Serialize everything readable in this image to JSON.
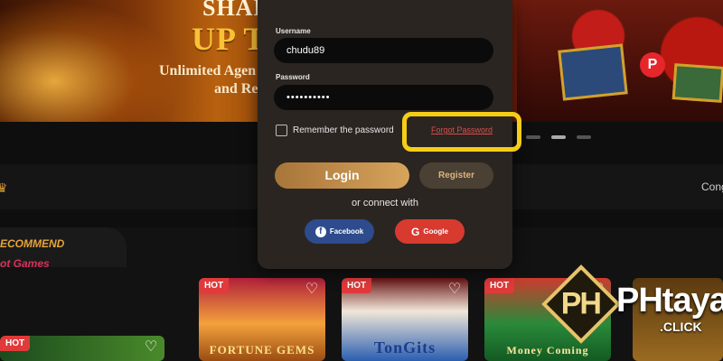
{
  "banner": {
    "headline_partial": "SHAR",
    "big_partial": "UP T",
    "line1_partial": "Unlimited Agen",
    "line2_partial": "and Re"
  },
  "nav": {
    "right_text_partial": "Cong"
  },
  "recommend": {
    "title_partial": "ECOMMEND",
    "subtitle_partial": "ot Games"
  },
  "games": [
    {
      "badge": "HOT",
      "name_partial": "FORTUNE GEMS"
    },
    {
      "badge": "HOT",
      "name": "TonGits"
    },
    {
      "badge": "HOT",
      "name_partial": "Money Coming"
    },
    {
      "badge": "HOT"
    }
  ],
  "brand": {
    "main": "PHtaya",
    "mark": "PH",
    "suffix": ".CLICK"
  },
  "login_form": {
    "username_label": "Username",
    "username_value": "chudu89",
    "password_label": "Password",
    "password_value": "••••••••••",
    "remember_label": "Remember the password",
    "forgot_label": "Forgot Password",
    "login_label": "Login",
    "register_label": "Register",
    "connect_label": "or connect with",
    "facebook_label": "Facebook",
    "google_label": "Google"
  },
  "colors": {
    "accent_gold": "#d7a45c",
    "highlight": "#f6cd16",
    "facebook": "#2d4b8d",
    "google": "#d83a30",
    "modal_bg": "#2b2521"
  },
  "icons": {
    "facebook": "facebook-icon",
    "google": "google-icon",
    "heart": "heart-icon"
  }
}
